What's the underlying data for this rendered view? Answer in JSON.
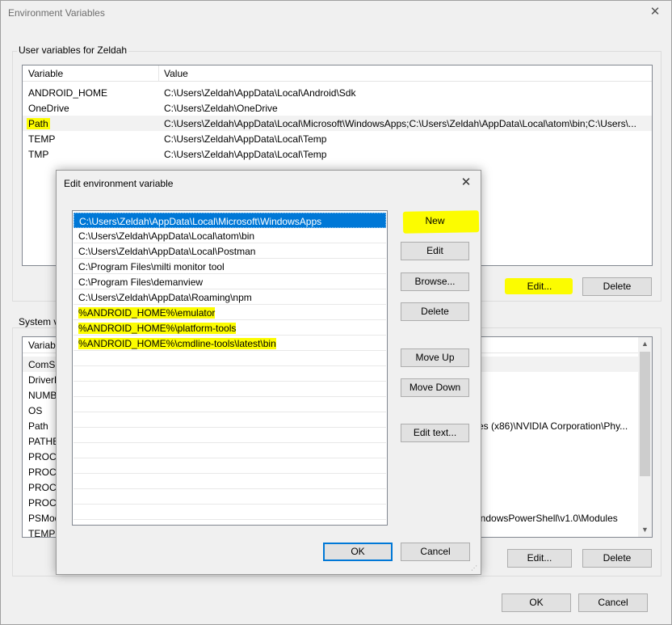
{
  "window": {
    "title": "Environment Variables",
    "close_glyph": "✕"
  },
  "user_vars": {
    "group_label": "User variables for Zeldah",
    "columns": [
      "Variable",
      "Value"
    ],
    "rows": [
      {
        "name": "ANDROID_HOME",
        "value": "C:\\Users\\Zeldah\\AppData\\Local\\Android\\Sdk"
      },
      {
        "name": "OneDrive",
        "value": "C:\\Users\\Zeldah\\OneDrive"
      },
      {
        "name": "Path",
        "value": "C:\\Users\\Zeldah\\AppData\\Local\\Microsoft\\WindowsApps;C:\\Users\\Zeldah\\AppData\\Local\\atom\\bin;C:\\Users\\..."
      },
      {
        "name": "TEMP",
        "value": "C:\\Users\\Zeldah\\AppData\\Local\\Temp"
      },
      {
        "name": "TMP",
        "value": "C:\\Users\\Zeldah\\AppData\\Local\\Temp"
      }
    ],
    "buttons": {
      "edit": "Edit...",
      "delete": "Delete"
    }
  },
  "system_vars": {
    "group_label": "System v",
    "column_first": "Variabl",
    "rows": [
      {
        "name": "ComSp",
        "value": ""
      },
      {
        "name": "DriverD",
        "value": ""
      },
      {
        "name": "NUMB",
        "value": ""
      },
      {
        "name": "OS",
        "value": ""
      },
      {
        "name": "Path",
        "value": "es (x86)\\NVIDIA Corporation\\Phy..."
      },
      {
        "name": "PATHE",
        "value": ""
      },
      {
        "name": "PROCE",
        "value": ""
      },
      {
        "name": "PROCE",
        "value": ""
      },
      {
        "name": "PROCE",
        "value": ""
      },
      {
        "name": "PROCE",
        "value": ""
      },
      {
        "name": "PSMod",
        "value": "indowsPowerShell\\v1.0\\Modules"
      },
      {
        "name": "TEMP",
        "value": ""
      }
    ],
    "buttons": {
      "edit": "Edit...",
      "delete": "Delete"
    }
  },
  "main_buttons": {
    "ok": "OK",
    "cancel": "Cancel"
  },
  "dialog": {
    "title": "Edit environment variable",
    "close_glyph": "✕",
    "entries": [
      "C:\\Users\\Zeldah\\AppData\\Local\\Microsoft\\WindowsApps",
      "C:\\Users\\Zeldah\\AppData\\Local\\atom\\bin",
      "C:\\Users\\Zeldah\\AppData\\Local\\Postman",
      "C:\\Program Files\\milti monitor tool",
      "C:\\Program Files\\demanview",
      "C:\\Users\\Zeldah\\AppData\\Roaming\\npm",
      "%ANDROID_HOME%\\emulator",
      "%ANDROID_HOME%\\platform-tools",
      "%ANDROID_HOME%\\cmdline-tools\\latest\\bin"
    ],
    "buttons": {
      "new": "New",
      "edit": "Edit",
      "browse": "Browse...",
      "delete": "Delete",
      "move_up": "Move Up",
      "move_down": "Move Down",
      "edit_text": "Edit text...",
      "ok": "OK",
      "cancel": "Cancel"
    }
  },
  "colors": {
    "highlight": "#fcfc00",
    "selection": "#0078d7"
  },
  "icons": {
    "scroll_up": "▲",
    "scroll_down": "▼",
    "size_grip": "⋰"
  }
}
